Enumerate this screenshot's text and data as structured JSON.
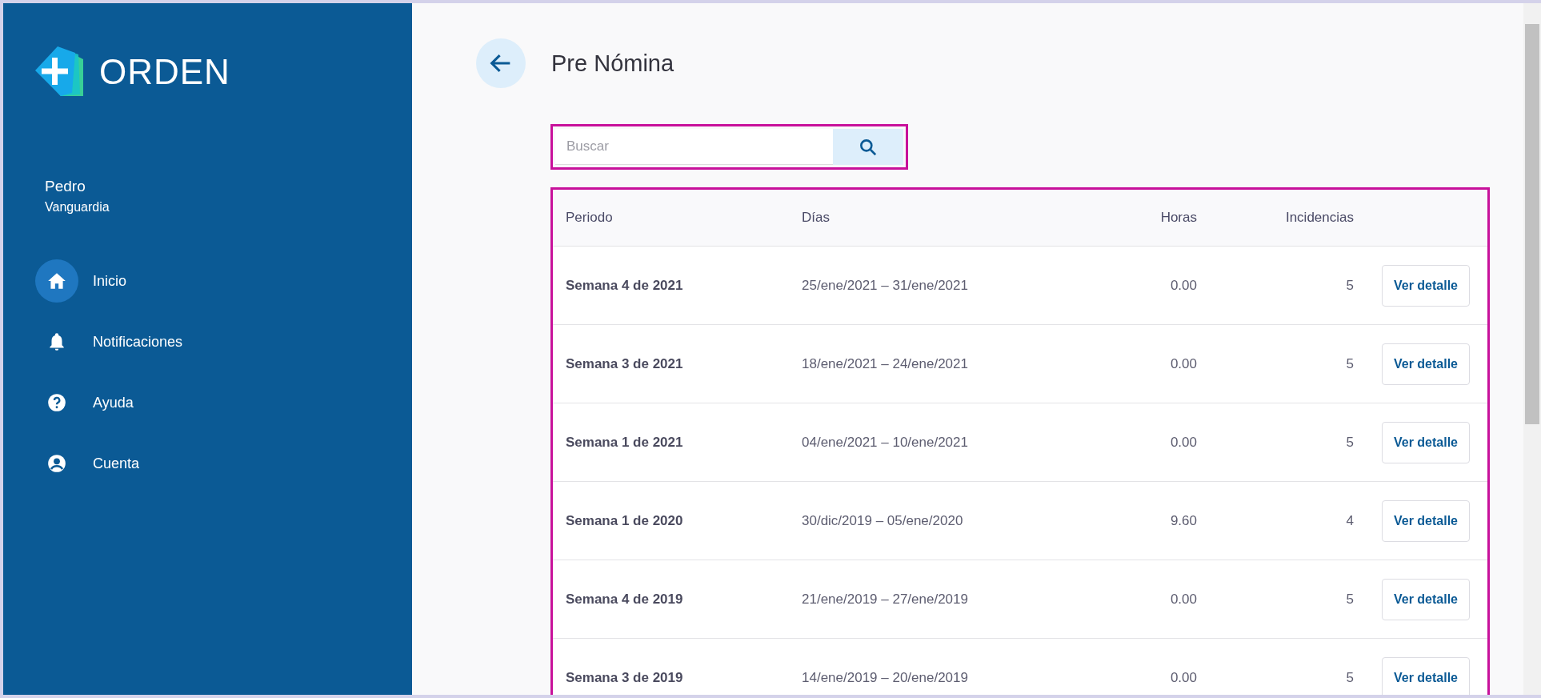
{
  "sidebar": {
    "logo": {
      "text": "ORDEN"
    },
    "user": {
      "name": "Pedro",
      "company": "Vanguardia"
    },
    "items": [
      {
        "label": "Inicio",
        "selected": true
      },
      {
        "label": "Notificaciones",
        "selected": false
      },
      {
        "label": "Ayuda",
        "selected": false
      },
      {
        "label": "Cuenta",
        "selected": false
      }
    ]
  },
  "page": {
    "title": "Pre Nómina"
  },
  "search": {
    "placeholder": "Buscar"
  },
  "table": {
    "columns": [
      "Periodo",
      "Días",
      "Horas",
      "Incidencias"
    ],
    "rows": [
      {
        "periodo": "Semana 4 de 2021",
        "dias": "25/ene/2021 – 31/ene/2021",
        "horas": "0.00",
        "incidencias": "5",
        "action": "Ver detalle"
      },
      {
        "periodo": "Semana 3 de 2021",
        "dias": "18/ene/2021 – 24/ene/2021",
        "horas": "0.00",
        "incidencias": "5",
        "action": "Ver detalle"
      },
      {
        "periodo": "Semana 1 de 2021",
        "dias": "04/ene/2021 – 10/ene/2021",
        "horas": "0.00",
        "incidencias": "5",
        "action": "Ver detalle"
      },
      {
        "periodo": "Semana 1 de 2020",
        "dias": "30/dic/2019 – 05/ene/2020",
        "horas": "9.60",
        "incidencias": "4",
        "action": "Ver detalle"
      },
      {
        "periodo": "Semana 4 de 2019",
        "dias": "21/ene/2019 – 27/ene/2019",
        "horas": "0.00",
        "incidencias": "5",
        "action": "Ver detalle"
      },
      {
        "periodo": "Semana 3 de 2019",
        "dias": "14/ene/2019 – 20/ene/2019",
        "horas": "0.00",
        "incidencias": "5",
        "action": "Ver detalle"
      }
    ]
  }
}
